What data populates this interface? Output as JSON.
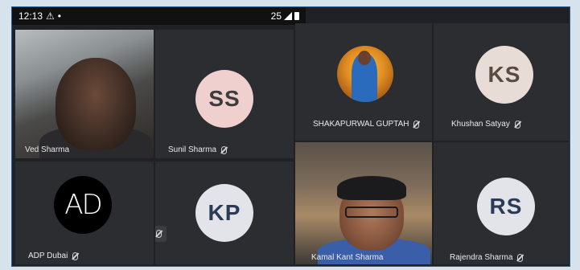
{
  "status_bar": {
    "time": "12:13",
    "network": "25"
  },
  "participants": [
    {
      "id": "p1",
      "name": "Ved Sharma",
      "type": "video"
    },
    {
      "id": "p2",
      "name": "Sunil Sharma",
      "initials": "SS",
      "type": "avatar"
    },
    {
      "id": "p3",
      "name": "SHAKAPURWAL GUPTAH",
      "type": "photo"
    },
    {
      "id": "p4",
      "name": "Khushan Satyay",
      "initials": "KS",
      "type": "avatar"
    },
    {
      "id": "p5",
      "name": "ADP Dubai",
      "initials": "AD",
      "type": "logo"
    },
    {
      "id": "p6",
      "name": "",
      "initials": "KP",
      "type": "avatar"
    },
    {
      "id": "p7",
      "name": "Kamal Kant Sharma",
      "type": "video"
    },
    {
      "id": "p8",
      "name": "Rajendra Sharma",
      "initials": "RS",
      "type": "avatar"
    }
  ],
  "colors": {
    "background": "#202124",
    "tile": "#2b2d31",
    "border": "#2b5b8c"
  }
}
